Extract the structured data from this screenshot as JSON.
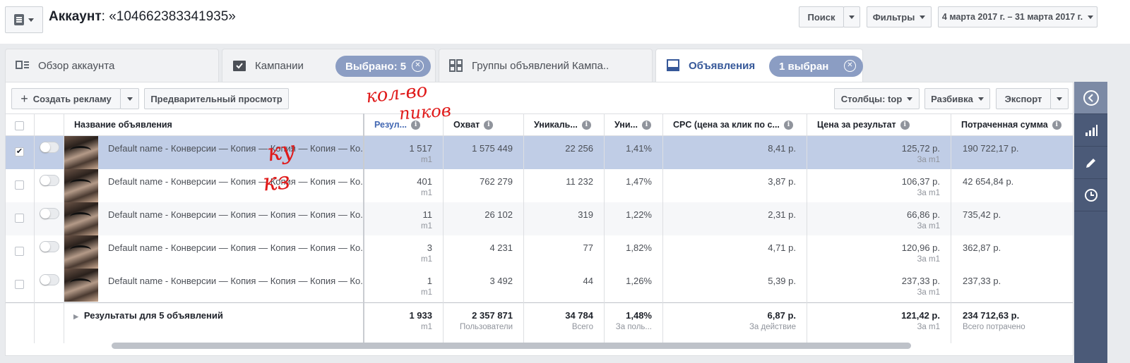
{
  "header": {
    "account_label": "Аккаунт",
    "account_value": ": «104662383341935»",
    "search_label": "Поиск",
    "filters_label": "Фильтры",
    "date_range": "4 марта 2017 г. – 31 марта 2017 г."
  },
  "tabs": [
    {
      "label": "Обзор аккаунта"
    },
    {
      "label": "Кампании",
      "pill": "Выбрано: 5"
    },
    {
      "label": "Группы объявлений Кампа.."
    },
    {
      "label": "Объявления",
      "pill": "1 выбран"
    }
  ],
  "toolbar": {
    "create_label": "Создать рекламу",
    "preview_label": "Предварительный просмотр",
    "columns_label": "Столбцы: top",
    "breakdown_label": "Разбивка",
    "export_label": "Экспорт"
  },
  "columns": [
    "Название объявления",
    "Резул...",
    "Охват",
    "Уникаль...",
    "Уни...",
    "CPC (цена за клик по с...",
    "Цена за результат",
    "Потраченная сумма"
  ],
  "rows": [
    {
      "name": "Default name - Конверсии — Копия — Копия — Копия — Ко...",
      "checked": "✔",
      "results": "1 517",
      "results_sub": "m1",
      "reach": "1 575 449",
      "unique": "22 256",
      "uni_pct": "1,41%",
      "cpc": "8,41 р.",
      "cost_per_result": "125,72 р.",
      "cost_sub": "За m1",
      "spent": "190 722,17 р."
    },
    {
      "name": "Default name - Конверсии — Копия — Копия — Копия — Ко...",
      "checked": "",
      "results": "401",
      "results_sub": "m1",
      "reach": "762 279",
      "unique": "11 232",
      "uni_pct": "1,47%",
      "cpc": "3,87 р.",
      "cost_per_result": "106,37 р.",
      "cost_sub": "За m1",
      "spent": "42 654,84 р."
    },
    {
      "name": "Default name - Конверсии — Копия — Копия — Копия — Ко...",
      "checked": "",
      "results": "11",
      "results_sub": "m1",
      "reach": "26 102",
      "unique": "319",
      "uni_pct": "1,22%",
      "cpc": "2,31 р.",
      "cost_per_result": "66,86 р.",
      "cost_sub": "За m1",
      "spent": "735,42 р."
    },
    {
      "name": "Default name - Конверсии — Копия — Копия — Копия — Ко...",
      "checked": "",
      "results": "3",
      "results_sub": "m1",
      "reach": "4 231",
      "unique": "77",
      "uni_pct": "1,82%",
      "cpc": "4,71 р.",
      "cost_per_result": "120,96 р.",
      "cost_sub": "За m1",
      "spent": "362,87 р."
    },
    {
      "name": "Default name - Конверсии — Копия — Копия — Копия — Ко...",
      "checked": "",
      "results": "1",
      "results_sub": "m1",
      "reach": "3 492",
      "unique": "44",
      "uni_pct": "1,26%",
      "cpc": "5,39 р.",
      "cost_per_result": "237,33 р.",
      "cost_sub": "За m1",
      "spent": "237,33 р."
    }
  ],
  "summary": {
    "label": "Результаты для 5 объявлений",
    "results": "1 933",
    "results_sub": "m1",
    "reach": "2 357 871",
    "reach_sub": "Пользователи",
    "unique": "34 784",
    "unique_sub": "Всего",
    "uni_pct": "1,48%",
    "uni_pct_sub": "За поль...",
    "cpc": "6,87 р.",
    "cpc_sub": "За действие",
    "cost_per_result": "121,42 р.",
    "cost_sub": "За m1",
    "spent": "234 712,63 р.",
    "spent_sub": "Всего потрачено"
  },
  "annotations": {
    "line1": "кол-во",
    "line2": "пиков",
    "line3": "ку",
    "line4": "кз"
  },
  "colors": {
    "selected_row": "#c0cde6",
    "accent": "#365899",
    "pill": "#8b9dc3",
    "sidebar": "#4b5a78",
    "scribble": "#e01b1b"
  }
}
